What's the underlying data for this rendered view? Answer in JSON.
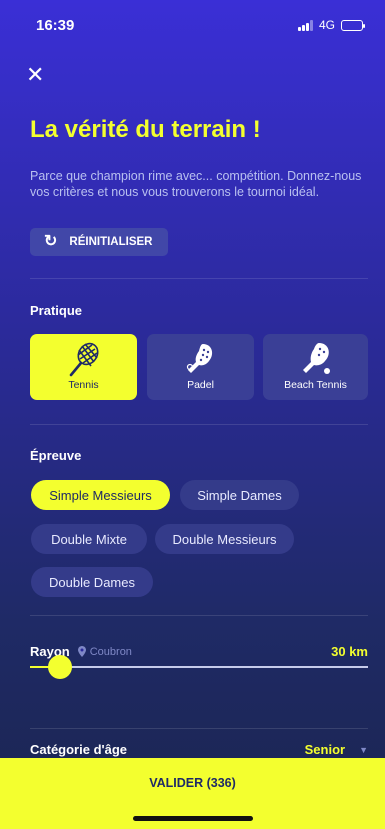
{
  "status": {
    "time": "16:39",
    "network": "4G"
  },
  "header": {
    "title": "La vérité du terrain !",
    "subtitle": "Parce que champion rime avec... compétition. Donnez-nous vos critères et nous vous trouverons le tournoi idéal."
  },
  "reset": {
    "label": "RÉINITIALISER"
  },
  "pratique": {
    "label": "Pratique",
    "options": [
      {
        "label": "Tennis",
        "selected": true,
        "icon": "tennis-racket-icon"
      },
      {
        "label": "Padel",
        "selected": false,
        "icon": "padel-racket-icon"
      },
      {
        "label": "Beach Tennis",
        "selected": false,
        "icon": "beach-tennis-racket-icon"
      }
    ]
  },
  "epreuve": {
    "label": "Épreuve",
    "options": [
      {
        "label": "Simple Messieurs",
        "selected": true
      },
      {
        "label": "Simple Dames",
        "selected": false
      },
      {
        "label": "Double Mixte",
        "selected": false
      },
      {
        "label": "Double Messieurs",
        "selected": false
      },
      {
        "label": "Double Dames",
        "selected": false
      }
    ]
  },
  "rayon": {
    "label": "Rayon",
    "location": "Coubron",
    "value": "30 km",
    "slider_fraction": 0.09
  },
  "age": {
    "label": "Catégorie d'âge",
    "value": "Senior"
  },
  "validate": {
    "label": "VALIDER (336)"
  },
  "colors": {
    "accent": "#f3ff2f",
    "background": "#2b2a9a",
    "card": "#3a3f96"
  }
}
